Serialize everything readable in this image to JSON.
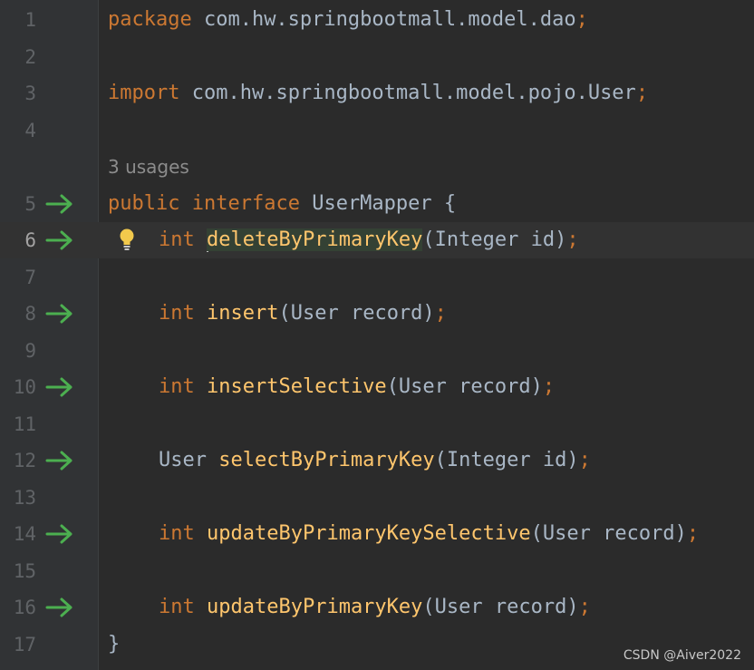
{
  "editor": {
    "lines": [
      {
        "num": "1",
        "package_kw": "package",
        "package_name": " com.hw.springbootmall.model.dao",
        "semi": ";"
      },
      {
        "num": "2"
      },
      {
        "num": "3",
        "import_kw": "import",
        "import_name": " com.hw.springbootmall.model.pojo.User",
        "semi": ";"
      },
      {
        "num": "4"
      },
      {
        "usages": "3 usages"
      },
      {
        "num": "5",
        "kw1": "public",
        "kw2": "interface",
        "name": "UserMapper",
        "brace": "{"
      },
      {
        "num": "6",
        "ret": "int",
        "method": "deleteByPrimaryKey",
        "params": "(Integer id)",
        "semi": ";"
      },
      {
        "num": "7"
      },
      {
        "num": "8",
        "ret": "int",
        "method": "insert",
        "params": "(User record)",
        "semi": ";"
      },
      {
        "num": "9"
      },
      {
        "num": "10",
        "ret": "int",
        "method": "insertSelective",
        "params": "(User record)",
        "semi": ";"
      },
      {
        "num": "11"
      },
      {
        "num": "12",
        "ret": "User",
        "method": "selectByPrimaryKey",
        "params": "(Integer id)",
        "semi": ";"
      },
      {
        "num": "13"
      },
      {
        "num": "14",
        "ret": "int",
        "method": "updateByPrimaryKeySelective",
        "params": "(User record)",
        "semi": ";"
      },
      {
        "num": "15"
      },
      {
        "num": "16",
        "ret": "int",
        "method": "updateByPrimaryKey",
        "params": "(User record)",
        "semi": ";"
      },
      {
        "num": "17",
        "close": "}"
      }
    ]
  },
  "watermark": "CSDN @Aiver2022",
  "colors": {
    "background": "#2b2b2b",
    "gutter": "#313335",
    "keyword": "#cc7832",
    "function": "#ffc66d",
    "text": "#a9b7c6",
    "line_number": "#606366",
    "implement_arrow": "#4caf50",
    "bulb": "#f2c94c"
  },
  "icons": {
    "gutter_marker": "implementation-arrow-icon",
    "intention": "lightbulb-icon"
  }
}
